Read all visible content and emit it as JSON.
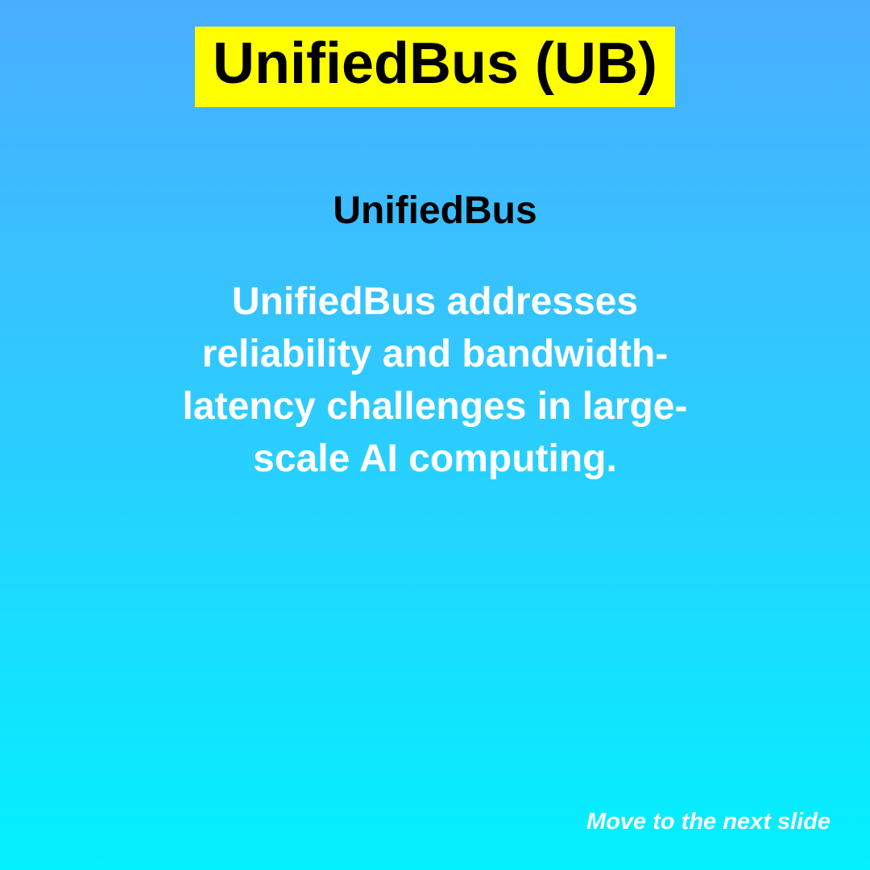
{
  "slide": {
    "title": "UnifiedBus (UB)",
    "subtitle": "UnifiedBus",
    "body": "UnifiedBus addresses reliability and bandwidth-latency challenges in large-scale AI computing.",
    "next_label": "Move to the next slide"
  },
  "colors": {
    "title_background": "#ffff00",
    "background_top": "#4aaeff",
    "background_bottom": "#02f0ff",
    "body_text": "#ffffff",
    "heading_text": "#000000"
  }
}
